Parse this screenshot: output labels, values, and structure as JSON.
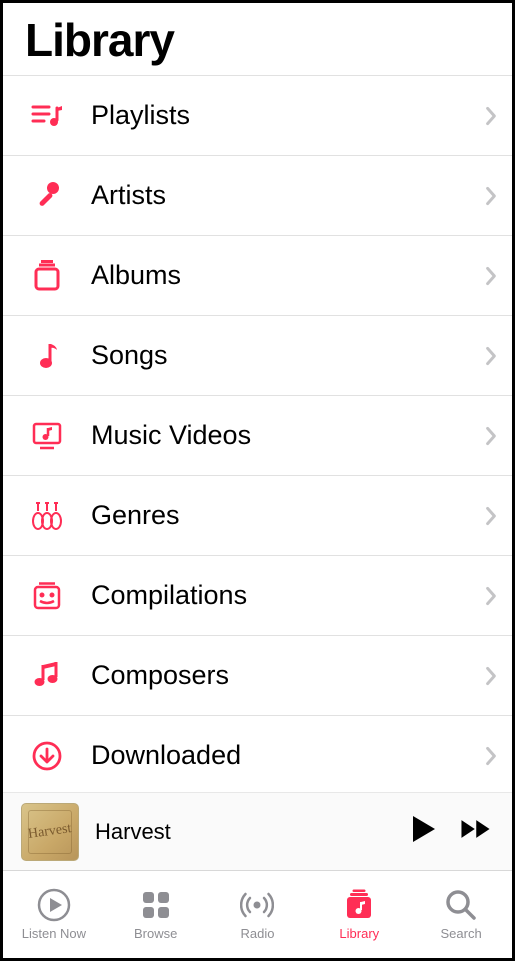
{
  "header": {
    "title": "Library"
  },
  "library_items": [
    {
      "id": "playlists",
      "label": "Playlists"
    },
    {
      "id": "artists",
      "label": "Artists"
    },
    {
      "id": "albums",
      "label": "Albums"
    },
    {
      "id": "songs",
      "label": "Songs"
    },
    {
      "id": "music-videos",
      "label": "Music Videos"
    },
    {
      "id": "genres",
      "label": "Genres"
    },
    {
      "id": "compilations",
      "label": "Compilations"
    },
    {
      "id": "composers",
      "label": "Composers"
    },
    {
      "id": "downloaded",
      "label": "Downloaded"
    }
  ],
  "now_playing": {
    "title": "Harvest",
    "artwork_text": "Harvest"
  },
  "tabs": [
    {
      "id": "listen-now",
      "label": "Listen Now",
      "active": false
    },
    {
      "id": "browse",
      "label": "Browse",
      "active": false
    },
    {
      "id": "radio",
      "label": "Radio",
      "active": false
    },
    {
      "id": "library",
      "label": "Library",
      "active": true
    },
    {
      "id": "search",
      "label": "Search",
      "active": false
    }
  ],
  "colors": {
    "accent": "#ff2d55",
    "inactive": "#8e8e93"
  }
}
